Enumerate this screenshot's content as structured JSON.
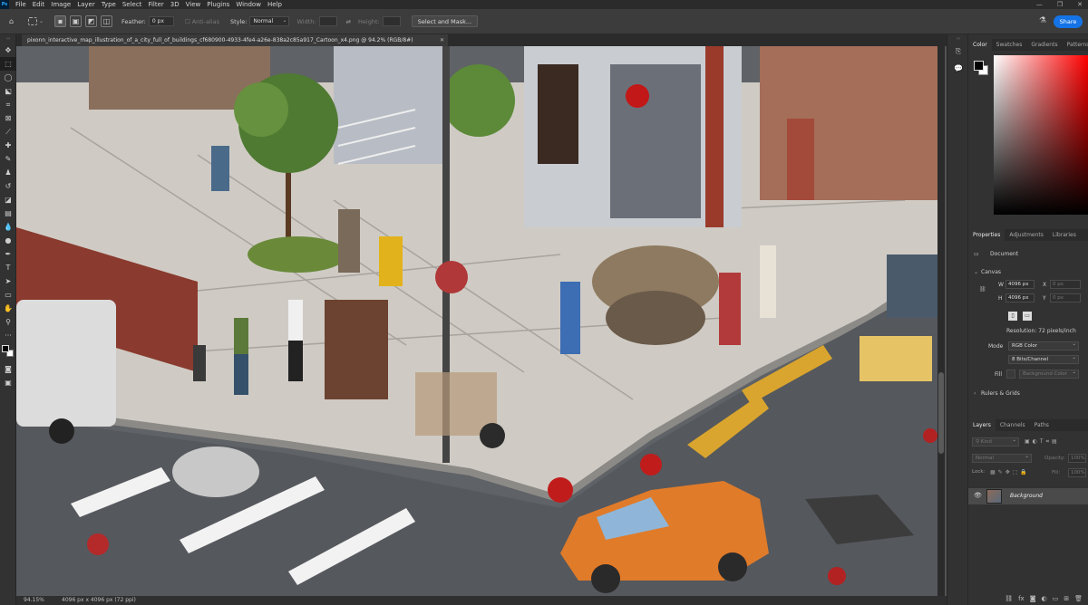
{
  "app": {
    "logo": "Ps",
    "menu": [
      "File",
      "Edit",
      "Image",
      "Layer",
      "Type",
      "Select",
      "Filter",
      "3D",
      "View",
      "Plugins",
      "Window",
      "Help"
    ],
    "window_controls": [
      "—",
      "❐",
      "✕"
    ]
  },
  "options": {
    "feather_label": "Feather:",
    "feather_value": "0 px",
    "antialias_label": "Anti-alias",
    "style_label": "Style:",
    "style_value": "Normal",
    "width_label": "Width:",
    "height_label": "Height:",
    "select_mask_label": "Select and Mask...",
    "share_label": "Share"
  },
  "document": {
    "tab_title": "pixonn_interactive_map_illustration_of_a_city_full_of_buildings_cf680900-4933-4fe4-a26e-838a2c85a917_Cartoon_x4.png @ 94.2% (RGB/8#)",
    "zoom_status": "94.15%",
    "doc_info": "4096 px x 4096 px (72 ppi)"
  },
  "color_panel": {
    "tabs": [
      "Color",
      "Swatches",
      "Gradients",
      "Patterns"
    ],
    "active_tab": "Color",
    "hue_color": "#ff0000"
  },
  "properties_panel": {
    "tabs": [
      "Properties",
      "Adjustments",
      "Libraries"
    ],
    "document_label": "Document",
    "canvas_section": "Canvas",
    "w_label": "W",
    "w_value": "4096 px",
    "h_label": "H",
    "h_value": "4096 px",
    "x_label": "X",
    "x_value": "0 px",
    "y_label": "Y",
    "y_value": "0 px",
    "resolution": "Resolution: 72 pixels/inch",
    "mode_label": "Mode",
    "mode_value": "RGB Color",
    "bits_value": "8 Bits/Channel",
    "fill_label": "Fill",
    "fill_value": "Background Color",
    "rulers_section": "Rulers & Grids"
  },
  "layers_panel": {
    "tabs": [
      "Layers",
      "Channels",
      "Paths"
    ],
    "kind_placeholder": "Kind",
    "blend_mode": "Normal",
    "opacity_label": "Opacity:",
    "opacity_value": "100%",
    "lock_label": "Lock:",
    "fill_label": "Fill:",
    "fill_value": "100%",
    "layers": [
      {
        "name": "Background",
        "visible": true
      }
    ]
  }
}
